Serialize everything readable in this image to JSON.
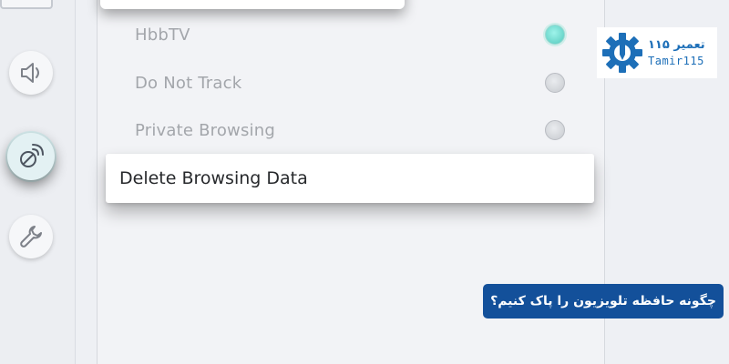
{
  "sidebar": {
    "items": [
      {
        "icon": "sound-icon"
      },
      {
        "icon": "broadcast-icon",
        "active": true
      },
      {
        "icon": "wrench-icon"
      }
    ]
  },
  "menu": {
    "items": [
      {
        "label": "HbbTV",
        "toggle": "on"
      },
      {
        "label": "Do Not Track",
        "toggle": "off"
      },
      {
        "label": "Private Browsing",
        "toggle": "off"
      }
    ],
    "selected_item": {
      "label": "Delete Browsing Data"
    }
  },
  "logo": {
    "line1": "تعمیر ۱۱۵",
    "line2": "Tamir115",
    "icon": "gear-wrench-icon",
    "color": "#1d6fb8"
  },
  "caption": {
    "text": "چگونه حافظه تلویزیون را پاک کنیم؟",
    "background": "#13509a"
  },
  "colors": {
    "toggle_on": "#55c9bd",
    "toggle_off": "#c6c9ce"
  }
}
